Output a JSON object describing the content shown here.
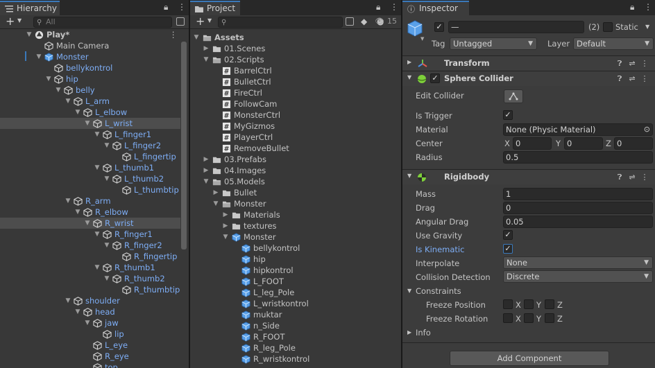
{
  "colors": {
    "prefab_blue": "#7eaef6",
    "tab_accent": "#3a79bb",
    "selection": "#4d4d4d"
  },
  "hierarchy": {
    "tab_label": "Hierarchy",
    "add_label": "+",
    "search_placeholder": "All",
    "rows": [
      {
        "label": "Play*",
        "depth": 0,
        "fold": "down",
        "icon": "unity-scene-icon",
        "prefab": false,
        "selected": false,
        "bold": true
      },
      {
        "label": "Main Camera",
        "depth": 1,
        "fold": "",
        "icon": "gameobject-icon",
        "prefab": false,
        "selected": false
      },
      {
        "label": "Monster",
        "depth": 1,
        "fold": "down",
        "icon": "prefab-icon",
        "prefab": true,
        "selected": false
      },
      {
        "label": "bellykontrol",
        "depth": 2,
        "fold": "",
        "icon": "gameobject-icon",
        "prefab": true,
        "selected": false
      },
      {
        "label": "hip",
        "depth": 2,
        "fold": "down",
        "icon": "gameobject-icon",
        "prefab": true,
        "selected": false
      },
      {
        "label": "belly",
        "depth": 3,
        "fold": "down",
        "icon": "gameobject-icon",
        "prefab": true,
        "selected": false
      },
      {
        "label": "L_arm",
        "depth": 4,
        "fold": "down",
        "icon": "gameobject-icon",
        "prefab": true,
        "selected": false
      },
      {
        "label": "L_elbow",
        "depth": 5,
        "fold": "down",
        "icon": "gameobject-icon",
        "prefab": true,
        "selected": false
      },
      {
        "label": "L_wrist",
        "depth": 6,
        "fold": "down",
        "icon": "gameobject-icon",
        "prefab": true,
        "selected": true
      },
      {
        "label": "L_finger1",
        "depth": 7,
        "fold": "down",
        "icon": "gameobject-icon",
        "prefab": true,
        "selected": false
      },
      {
        "label": "L_finger2",
        "depth": 8,
        "fold": "down",
        "icon": "gameobject-icon",
        "prefab": true,
        "selected": false
      },
      {
        "label": "L_fingertip",
        "depth": 9,
        "fold": "",
        "icon": "gameobject-icon",
        "prefab": true,
        "selected": false
      },
      {
        "label": "L_thumb1",
        "depth": 7,
        "fold": "down",
        "icon": "gameobject-icon",
        "prefab": true,
        "selected": false
      },
      {
        "label": "L_thumb2",
        "depth": 8,
        "fold": "down",
        "icon": "gameobject-icon",
        "prefab": true,
        "selected": false
      },
      {
        "label": "L_thumbtip",
        "depth": 9,
        "fold": "",
        "icon": "gameobject-icon",
        "prefab": true,
        "selected": false
      },
      {
        "label": "R_arm",
        "depth": 4,
        "fold": "down",
        "icon": "gameobject-icon",
        "prefab": true,
        "selected": false
      },
      {
        "label": "R_elbow",
        "depth": 5,
        "fold": "down",
        "icon": "gameobject-icon",
        "prefab": true,
        "selected": false
      },
      {
        "label": "R_wrist",
        "depth": 6,
        "fold": "down",
        "icon": "gameobject-icon",
        "prefab": true,
        "selected": true
      },
      {
        "label": "R_finger1",
        "depth": 7,
        "fold": "down",
        "icon": "gameobject-icon",
        "prefab": true,
        "selected": false
      },
      {
        "label": "R_finger2",
        "depth": 8,
        "fold": "down",
        "icon": "gameobject-icon",
        "prefab": true,
        "selected": false
      },
      {
        "label": "R_fingertip",
        "depth": 9,
        "fold": "",
        "icon": "gameobject-icon",
        "prefab": true,
        "selected": false
      },
      {
        "label": "R_thumb1",
        "depth": 7,
        "fold": "down",
        "icon": "gameobject-icon",
        "prefab": true,
        "selected": false
      },
      {
        "label": "R_thumb2",
        "depth": 8,
        "fold": "down",
        "icon": "gameobject-icon",
        "prefab": true,
        "selected": false
      },
      {
        "label": "R_thumbtip",
        "depth": 9,
        "fold": "",
        "icon": "gameobject-icon",
        "prefab": true,
        "selected": false
      },
      {
        "label": "shoulder",
        "depth": 4,
        "fold": "down",
        "icon": "gameobject-icon",
        "prefab": true,
        "selected": false
      },
      {
        "label": "head",
        "depth": 5,
        "fold": "down",
        "icon": "gameobject-icon",
        "prefab": true,
        "selected": false
      },
      {
        "label": "jaw",
        "depth": 6,
        "fold": "down",
        "icon": "gameobject-icon",
        "prefab": true,
        "selected": false
      },
      {
        "label": "lip",
        "depth": 7,
        "fold": "",
        "icon": "gameobject-icon",
        "prefab": true,
        "selected": false
      },
      {
        "label": "L_eye",
        "depth": 6,
        "fold": "",
        "icon": "gameobject-icon",
        "prefab": true,
        "selected": false
      },
      {
        "label": "R_eye",
        "depth": 6,
        "fold": "",
        "icon": "gameobject-icon",
        "prefab": true,
        "selected": false
      },
      {
        "label": "top",
        "depth": 6,
        "fold": "",
        "icon": "gameobject-icon",
        "prefab": true,
        "selected": false
      }
    ]
  },
  "project": {
    "tab_label": "Project",
    "add_label": "+",
    "hidden_count": "15",
    "rows": [
      {
        "label": "Assets",
        "depth": 0,
        "fold": "down",
        "icon": "folder-open-icon",
        "bold": true
      },
      {
        "label": "01.Scenes",
        "depth": 1,
        "fold": "right",
        "icon": "folder-icon"
      },
      {
        "label": "02.Scripts",
        "depth": 1,
        "fold": "down",
        "icon": "folder-open-icon"
      },
      {
        "label": "BarrelCtrl",
        "depth": 2,
        "fold": "",
        "icon": "script-icon"
      },
      {
        "label": "BulletCtrl",
        "depth": 2,
        "fold": "",
        "icon": "script-icon"
      },
      {
        "label": "FireCtrl",
        "depth": 2,
        "fold": "",
        "icon": "script-icon"
      },
      {
        "label": "FollowCam",
        "depth": 2,
        "fold": "",
        "icon": "script-icon"
      },
      {
        "label": "MonsterCtrl",
        "depth": 2,
        "fold": "",
        "icon": "script-icon"
      },
      {
        "label": "MyGizmos",
        "depth": 2,
        "fold": "",
        "icon": "script-icon"
      },
      {
        "label": "PlayerCtrl",
        "depth": 2,
        "fold": "",
        "icon": "script-icon"
      },
      {
        "label": "RemoveBullet",
        "depth": 2,
        "fold": "",
        "icon": "script-icon"
      },
      {
        "label": "03.Prefabs",
        "depth": 1,
        "fold": "right",
        "icon": "folder-icon"
      },
      {
        "label": "04.Images",
        "depth": 1,
        "fold": "right",
        "icon": "folder-icon"
      },
      {
        "label": "05.Models",
        "depth": 1,
        "fold": "down",
        "icon": "folder-open-icon"
      },
      {
        "label": "Bullet",
        "depth": 2,
        "fold": "right",
        "icon": "folder-icon"
      },
      {
        "label": "Monster",
        "depth": 2,
        "fold": "down",
        "icon": "folder-open-icon"
      },
      {
        "label": "Materials",
        "depth": 3,
        "fold": "right",
        "icon": "folder-icon"
      },
      {
        "label": "textures",
        "depth": 3,
        "fold": "right",
        "icon": "folder-icon"
      },
      {
        "label": "Monster",
        "depth": 3,
        "fold": "down",
        "icon": "model-icon"
      },
      {
        "label": "bellykontrol",
        "depth": 4,
        "fold": "",
        "icon": "model-icon"
      },
      {
        "label": "hip",
        "depth": 4,
        "fold": "",
        "icon": "model-icon"
      },
      {
        "label": "hipkontrol",
        "depth": 4,
        "fold": "",
        "icon": "model-icon"
      },
      {
        "label": "L_FOOT",
        "depth": 4,
        "fold": "",
        "icon": "model-icon"
      },
      {
        "label": "L_leg_Pole",
        "depth": 4,
        "fold": "",
        "icon": "model-icon"
      },
      {
        "label": "L_wristkontrol",
        "depth": 4,
        "fold": "",
        "icon": "model-icon"
      },
      {
        "label": "muktar",
        "depth": 4,
        "fold": "",
        "icon": "model-icon"
      },
      {
        "label": "n_Side",
        "depth": 4,
        "fold": "",
        "icon": "model-icon"
      },
      {
        "label": "R_FOOT",
        "depth": 4,
        "fold": "",
        "icon": "model-icon"
      },
      {
        "label": "R_leg_Pole",
        "depth": 4,
        "fold": "",
        "icon": "model-icon"
      },
      {
        "label": "R_wristkontrol",
        "depth": 4,
        "fold": "",
        "icon": "model-icon"
      }
    ]
  },
  "inspector": {
    "tab_label": "Inspector",
    "name_value": "—",
    "multi_count": "(2)",
    "static_label": "Static",
    "tag_label": "Tag",
    "tag_value": "Untagged",
    "layer_label": "Layer",
    "layer_value": "Default",
    "transform_title": "Transform",
    "sphere_collider": {
      "title": "Sphere Collider",
      "edit_collider_label": "Edit Collider",
      "is_trigger_label": "Is Trigger",
      "material_label": "Material",
      "material_value": "None (Physic Material)",
      "center_label": "Center",
      "center_x": "0",
      "center_y": "0",
      "center_z": "0",
      "radius_label": "Radius",
      "radius_value": "0.5"
    },
    "rigidbody": {
      "title": "Rigidbody",
      "mass_label": "Mass",
      "mass_value": "1",
      "drag_label": "Drag",
      "drag_value": "0",
      "angular_drag_label": "Angular Drag",
      "angular_drag_value": "0.05",
      "use_gravity_label": "Use Gravity",
      "is_kinematic_label": "Is Kinematic",
      "interpolate_label": "Interpolate",
      "interpolate_value": "None",
      "collision_label": "Collision Detection",
      "collision_value": "Discrete",
      "constraints_label": "Constraints",
      "freeze_position_label": "Freeze Position",
      "freeze_rotation_label": "Freeze Rotation",
      "x": "X",
      "y": "Y",
      "z": "Z"
    },
    "info_label": "Info",
    "add_component_label": "Add Component"
  }
}
